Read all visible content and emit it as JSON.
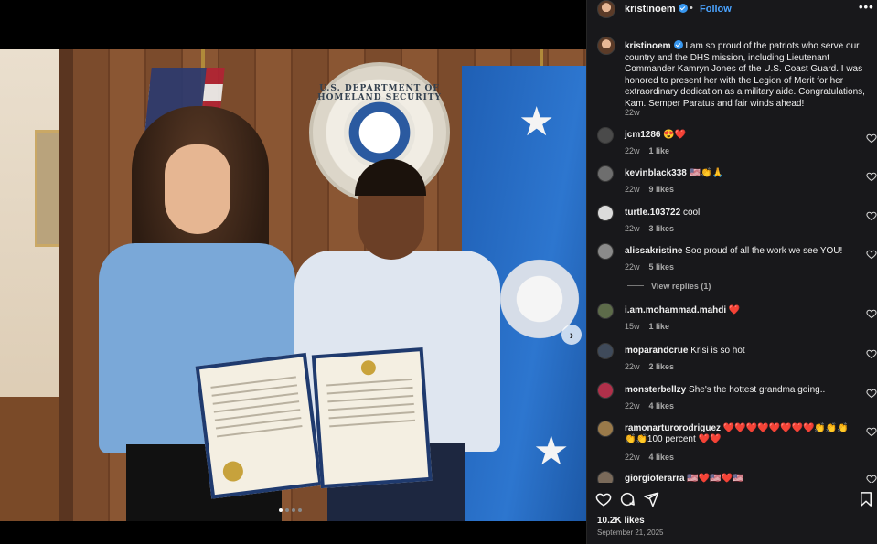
{
  "post": {
    "image_alt": "Kristi Noem presenting the Legion of Merit certificate to Lieutenant Commander Kamryn Jones",
    "seal_text": "U.S. DEPARTMENT OF HOMELAND SECURITY",
    "carousel": {
      "total": 4,
      "active": 1
    },
    "next_glyph": "›"
  },
  "header": {
    "username": "kristinoem",
    "separator": "•",
    "follow_label": "Follow",
    "more_glyph": "•••"
  },
  "caption": {
    "username": "kristinoem",
    "text": "I am so proud of the patriots who serve our country and the DHS mission, including Lieutenant Commander Kamryn Jones of the U.S. Coast Guard. I was honored to present her with the Legion of Merit for her extraordinary dedication as a military aide. Congratulations, Kam. Semper Paratus and fair winds ahead!",
    "time": "22w"
  },
  "comments": [
    {
      "username": "jcm1286",
      "text": "😍❤️",
      "time": "22w",
      "likes": "1 like",
      "avatar_color": "#4a4a4a"
    },
    {
      "username": "kevinblack338",
      "text": "🇺🇸👏🙏",
      "time": "22w",
      "likes": "9 likes",
      "avatar_color": "#6e6e6e"
    },
    {
      "username": "turtle.103722",
      "text": "cool",
      "time": "22w",
      "likes": "3 likes",
      "avatar_color": "#dbdbdb"
    },
    {
      "username": "alissakristine",
      "text": "Soo proud of all the work we see YOU!",
      "time": "22w",
      "likes": "5 likes",
      "avatar_color": "#8a8a8a",
      "replies": "View replies (1)"
    },
    {
      "username": "i.am.mohammad.mahdi",
      "text": "❤️",
      "time": "15w",
      "likes": "1 like",
      "avatar_color": "#5d6b4a"
    },
    {
      "username": "moparandcrue",
      "text": "Krisi is so hot",
      "time": "22w",
      "likes": "2 likes",
      "avatar_color": "#3f4a5a"
    },
    {
      "username": "monsterbellzy",
      "text": "She's the hottest grandma going..",
      "time": "22w",
      "likes": "4 likes",
      "avatar_color": "#b0304a"
    },
    {
      "username": "ramonarturorodriguez",
      "text": "❤️❤️❤️❤️❤️❤️❤️❤️👏👏👏👏👏100 percent ❤️❤️",
      "time": "22w",
      "likes": "4 likes",
      "avatar_color": "#9a7a4a"
    },
    {
      "username": "giorgioferarra",
      "text": "🇺🇸❤️🇺🇸❤️🇺🇸",
      "time": "",
      "likes": "",
      "avatar_color": "#7a6a5a"
    }
  ],
  "footer": {
    "likes_total": "10.2K likes",
    "date": "September 21, 2025"
  },
  "colors": {
    "link_blue": "#4aa3ff",
    "verified_blue": "#3797f0",
    "panel_bg": "#18181b",
    "muted_text": "#a8a8a8"
  },
  "icons": {
    "actions": [
      "heart-icon",
      "comment-icon",
      "share-icon",
      "bookmark-icon"
    ],
    "comment_like": "heart-outline-icon"
  }
}
